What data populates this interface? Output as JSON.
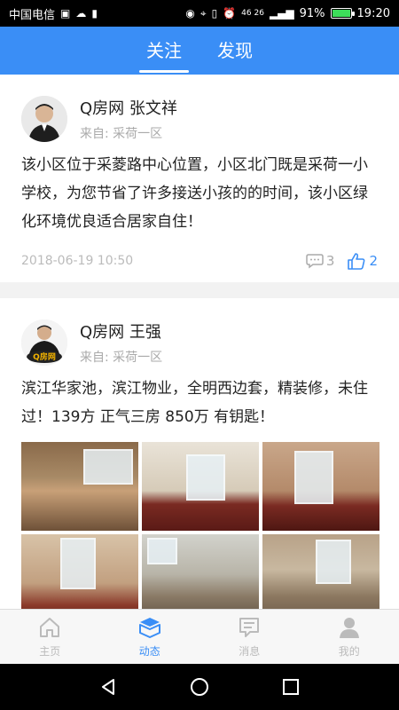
{
  "status_bar": {
    "carrier": "中国电信",
    "network": "46 26",
    "battery": "91%",
    "battery_level": 0.91,
    "time": "19:20"
  },
  "top_tabs": [
    {
      "label": "关注",
      "active": true
    },
    {
      "label": "发现",
      "active": false
    }
  ],
  "posts": [
    {
      "author": "Q房网 张文祥",
      "source": "来自: 采荷一区",
      "text": "该小区位于采菱路中心位置，小区北门既是采荷一小学校，为您节省了许多接送小孩的的时间，该小区绿化环境优良适合居家自住！",
      "date": "2018-06-19 10:50",
      "comments": "3",
      "likes": "2"
    },
    {
      "author": "Q房网 王强",
      "source": "来自: 采荷一区",
      "text": "滨江华家池，滨江物业，全明西边套，精装修，未住过！139方 正气三房 850万 有钥匙！",
      "avatar_badge": "Q房网"
    }
  ],
  "bottom_nav": [
    {
      "label": "主页",
      "icon": "home-icon",
      "active": false
    },
    {
      "label": "动态",
      "icon": "box-icon",
      "active": true
    },
    {
      "label": "消息",
      "icon": "message-icon",
      "active": false
    },
    {
      "label": "我的",
      "icon": "person-icon",
      "active": false
    }
  ],
  "colors": {
    "accent": "#3a8ef6",
    "inactive": "#bbbbbb"
  }
}
